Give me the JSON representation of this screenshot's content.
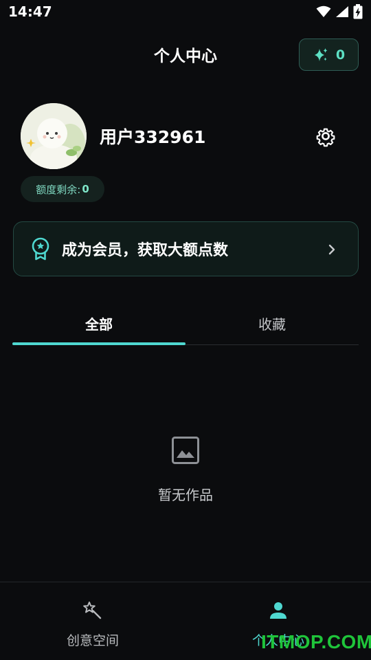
{
  "status_bar": {
    "time": "14:47",
    "icons": [
      "wifi-icon",
      "signal-icon",
      "battery-charging-icon"
    ]
  },
  "header": {
    "title": "个人中心",
    "credit_count": "0",
    "credit_icon": "sparkle-icon"
  },
  "profile": {
    "username": "用户332961",
    "quota_label": "额度剩余:",
    "quota_value": "0",
    "settings_icon": "gear-icon"
  },
  "member_banner": {
    "text": "成为会员，获取大额点数",
    "icon": "award-badge-icon"
  },
  "tabs": [
    {
      "label": "全部",
      "active": true
    },
    {
      "label": "收藏",
      "active": false
    }
  ],
  "empty_state": {
    "icon": "image-icon",
    "text": "暂无作品"
  },
  "bottom_nav": [
    {
      "label": "创意空间",
      "icon": "magic-wand-icon",
      "active": false
    },
    {
      "label": "个人中心",
      "icon": "person-icon",
      "active": true
    }
  ],
  "watermark": "ITMOP.COM",
  "colors": {
    "accent": "#4fd8d0",
    "background": "#0b0c0e",
    "chip_text": "#5de0c4"
  }
}
